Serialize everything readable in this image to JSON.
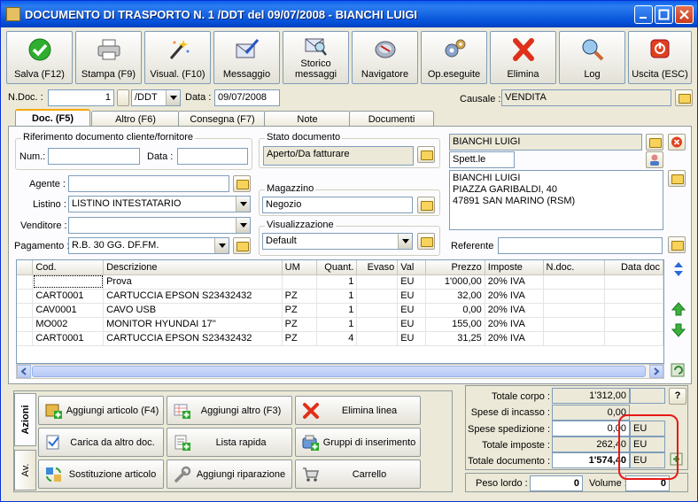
{
  "window": {
    "title": "DOCUMENTO DI TRASPORTO N. 1 /DDT del 09/07/2008 - BIANCHI LUIGI"
  },
  "toolbar": {
    "buttons": [
      {
        "label": "Salva (F12)",
        "icon": "save-check-icon"
      },
      {
        "label": "Stampa (F9)",
        "icon": "printer-icon"
      },
      {
        "label": "Visual. (F10)",
        "icon": "magic-wand-icon"
      },
      {
        "label": "Messaggio",
        "icon": "envelope-pen-icon"
      },
      {
        "label": "Storico messaggi",
        "icon": "envelope-search-icon",
        "line1": "Storico",
        "line2": "messaggi"
      },
      {
        "label": "Navigatore",
        "icon": "navigator-icon"
      },
      {
        "label": "Op.eseguite",
        "icon": "gears-icon"
      },
      {
        "label": "Elimina",
        "icon": "delete-x-icon"
      },
      {
        "label": "Log",
        "icon": "log-search-icon"
      },
      {
        "label": "Uscita (ESC)",
        "icon": "exit-icon"
      }
    ]
  },
  "header": {
    "ndoc_label": "N.Doc. :",
    "ndoc_value": "1",
    "series_value": "/DDT",
    "date_label": "Data :",
    "date_value": "09/07/2008",
    "causale_label": "Causale :",
    "causale_value": "VENDITA"
  },
  "tabs": [
    "Doc. (F5)",
    "Altro (F6)",
    "Consegna (F7)",
    "Note",
    "Documenti"
  ],
  "doc": {
    "rif_group_title": "Riferimento documento cliente/fornitore",
    "num_label": "Num.:",
    "num_value": "",
    "data_label": "Data :",
    "data_value": "",
    "agente_label": "Agente :",
    "agente_value": "",
    "listino_label": "Listino :",
    "listino_value": "LISTINO INTESTATARIO",
    "venditore_label": "Venditore :",
    "venditore_value": "",
    "pagamento_label": "Pagamento :",
    "pagamento_value": "R.B. 30 GG. DF.FM.",
    "stato_title": "Stato documento",
    "stato_value": "Aperto/Da fatturare",
    "magazzino_title": "Magazzino",
    "magazzino_value": "Negozio",
    "visual_title": "Visualizzazione",
    "visual_value": "Default",
    "cliente_name": "BIANCHI LUIGI",
    "cliente_title": "Spett.le",
    "address_lines": [
      "BIANCHI LUIGI",
      "PIAZZA GARIBALDI, 40",
      "47891 SAN MARINO (RSM)"
    ],
    "referente_label": "Referente",
    "referente_value": ""
  },
  "grid": {
    "columns": [
      "Cod.",
      "Descrizione",
      "UM",
      "Quant.",
      "Evaso",
      "Val",
      "Prezzo",
      "Imposte",
      "N.doc.",
      "Data doc"
    ],
    "rows": [
      [
        "",
        "Prova",
        "",
        "1",
        "",
        "EU",
        "1'000,00",
        "20% IVA",
        "",
        ""
      ],
      [
        "CART0001",
        "CARTUCCIA EPSON S23432432",
        "PZ",
        "1",
        "",
        "EU",
        "32,00",
        "20% IVA",
        "",
        ""
      ],
      [
        "CAV0001",
        "CAVO USB",
        "PZ",
        "1",
        "",
        "EU",
        "0,00",
        "20% IVA",
        "",
        ""
      ],
      [
        "MO002",
        "MONITOR HYUNDAI 17''",
        "PZ",
        "1",
        "",
        "EU",
        "155,00",
        "20% IVA",
        "",
        ""
      ],
      [
        "CART0001",
        "CARTUCCIA EPSON S23432432",
        "PZ",
        "4",
        "",
        "EU",
        "31,25",
        "20% IVA",
        "",
        ""
      ]
    ]
  },
  "actions": {
    "tab_azioni": "Azioni",
    "tab_av": "Av.",
    "buttons": [
      {
        "label": "Aggiungi articolo (F4)",
        "icon": "add-article-icon"
      },
      {
        "label": "Aggiungi altro (F3)",
        "icon": "add-other-icon"
      },
      {
        "label": "Elimina linea",
        "icon": "delete-line-icon"
      },
      {
        "label": "Carica da altro doc.",
        "icon": "load-doc-icon"
      },
      {
        "label": "Lista rapida",
        "icon": "quick-list-icon"
      },
      {
        "label": "Gruppi di inserimento",
        "icon": "groups-icon"
      },
      {
        "label": "Sostituzione articolo",
        "icon": "replace-article-icon"
      },
      {
        "label": "Aggiungi riparazione",
        "icon": "repair-icon"
      },
      {
        "label": "Carrello",
        "icon": "cart-icon"
      }
    ]
  },
  "totals": {
    "totale_corpo_label": "Totale corpo :",
    "totale_corpo_value": "1'312,00",
    "spese_incasso_label": "Spese di incasso :",
    "spese_incasso_value": "0,00",
    "spese_spedizione_label": "Spese spedizione :",
    "spese_spedizione_value": "0,00",
    "spese_spedizione_cur": "EU",
    "totale_imposte_label": "Totale imposte :",
    "totale_imposte_value": "262,40",
    "totale_imposte_cur": "EU",
    "totale_documento_label": "Totale documento :",
    "totale_documento_value": "1'574,40",
    "totale_documento_cur": "EU",
    "help_label": "?",
    "peso_label": "Peso lordo :",
    "peso_value": "0",
    "volume_label": "Volume :",
    "volume_value": "0"
  }
}
